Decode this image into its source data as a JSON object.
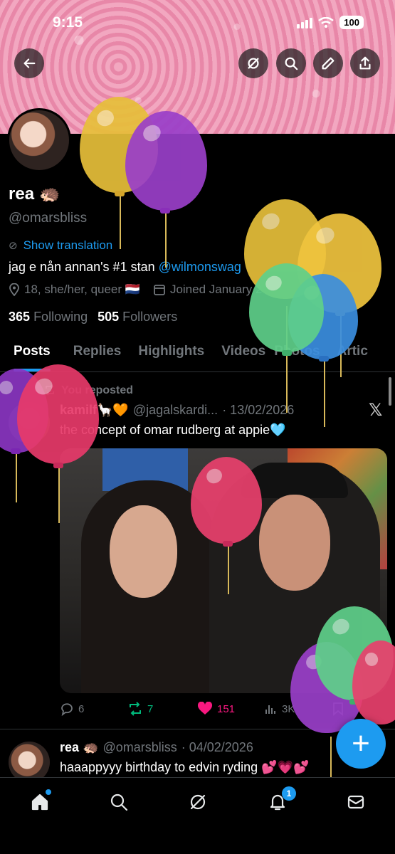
{
  "status_bar": {
    "time": "9:15",
    "battery": "100"
  },
  "profile": {
    "name": "rea 🦔",
    "handle": "@omarsbliss",
    "show_translation": "Show translation",
    "bio_text": "jag e nån annan's #1 stan ",
    "bio_mention": "@wilmonswag",
    "location": "18, she/her, queer 🇳🇱",
    "joined": "Joined January 2",
    "following_count": "365",
    "following_label": "Following",
    "followers_count": "505",
    "followers_label": "Followers"
  },
  "tabs": [
    "Posts",
    "Replies",
    "Highlights",
    "Videos",
    "Photos",
    "Artic"
  ],
  "posts": [
    {
      "repost_label": "You reposted",
      "name": "kamilf🦙🧡",
      "handle": "@jagalskardi...",
      "date": "· 13/02/2026",
      "text": "the concept of omar rudberg at appie🩵",
      "replies": "6",
      "reposts": "7",
      "likes": "151",
      "views": "3K"
    },
    {
      "name": "rea 🦔",
      "handle": "@omarsbliss",
      "date": "· 04/02/2026",
      "text": "haaappyyy birthday to edvin ryding 💕💗💕"
    }
  ],
  "nav": {
    "notifications_badge": "1"
  },
  "x_logo": "𝕏",
  "fab_label": "+",
  "colors": {
    "accent": "#1d9bf0",
    "like": "#f91880",
    "repost": "#00ba7c",
    "banner": "#ef9bb8"
  },
  "icons": [
    "back-icon",
    "grok-icon",
    "search-icon",
    "edit-icon",
    "share-icon",
    "home-icon",
    "explore-icon",
    "notifications-icon",
    "messages-icon"
  ]
}
